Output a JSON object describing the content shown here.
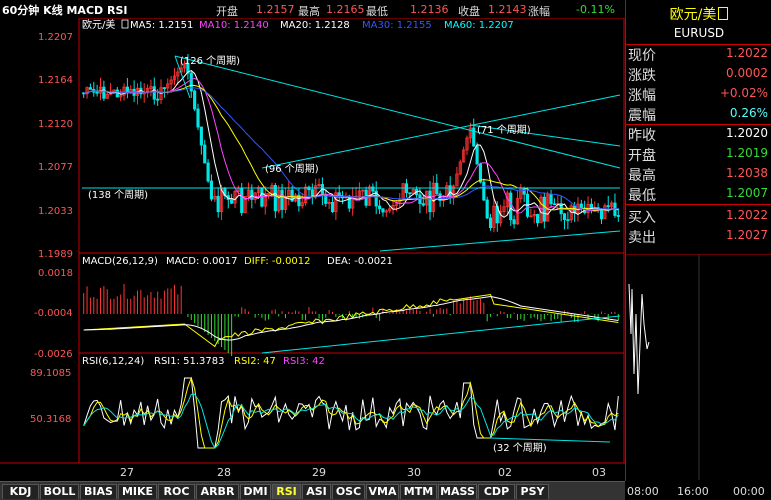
{
  "header": {
    "title": "60分钟 K线 MACD RSI",
    "open_label": "开盘",
    "open": "1.2157",
    "high_label": "最高",
    "high": "1.2165",
    "low_label": "最低",
    "low": "1.2136",
    "close_label": "收盘",
    "close": "1.2143",
    "change_label": "涨幅",
    "change": "-0.11%"
  },
  "kline": {
    "name": "欧元/美",
    "ma5": "MA5: 1.2151",
    "ma10": "MA10: 1.2140",
    "ma20": "MA20: 1.2128",
    "ma30": "MA30: 1.2155",
    "ma60": "MA60: 1.2207",
    "y_ticks": [
      "1.2207",
      "1.2164",
      "1.2120",
      "1.2077",
      "1.2033",
      "1.1989"
    ],
    "annotations": [
      "(126 个周期)",
      "(71 个周期)",
      "(96 个周期)",
      "(138 个周期)"
    ]
  },
  "macd": {
    "label": "MACD(26,12,9)",
    "macd": "MACD: 0.0017",
    "diff": "DIFF: -0.0012",
    "dea": "DEA: -0.0021",
    "y_ticks": [
      "0.0018",
      "-0.0004",
      "-0.0026"
    ]
  },
  "rsi": {
    "label": "RSI(6,12,24)",
    "rsi1": "RSI1: 51.3783",
    "rsi2": "RSI2: 47",
    "rsi3": "RSI3: 42",
    "y_ticks": [
      "89.1085",
      "50.3168"
    ],
    "annotation": "(32 个周期)"
  },
  "xaxis": [
    "27",
    "28",
    "29",
    "30",
    "02",
    "03"
  ],
  "tabs": [
    "KDJ",
    "BOLL",
    "BIAS",
    "MIKE",
    "ROC",
    "ARBR",
    "DMI",
    "RSI",
    "ASI",
    "OSC",
    "VMA",
    "MTM",
    "MASS",
    "CDP",
    "PSY"
  ],
  "active_tab": "RSI",
  "side": {
    "name": "欧元/美",
    "code": "EURUSD",
    "rows": [
      {
        "label": "现价",
        "value": "1.2022",
        "color": "#ff5555"
      },
      {
        "label": "涨跌",
        "value": "0.0002",
        "color": "#ff5555"
      },
      {
        "label": "涨幅",
        "value": "+0.02%",
        "color": "#ff5555"
      },
      {
        "label": "震幅",
        "value": "0.26%",
        "color": "#55ffff"
      },
      {
        "label": "昨收",
        "value": "1.2020",
        "color": "#ffffff"
      },
      {
        "label": "开盘",
        "value": "1.2019",
        "color": "#33dd33"
      },
      {
        "label": "最高",
        "value": "1.2038",
        "color": "#ff5555"
      },
      {
        "label": "最低",
        "value": "1.2007",
        "color": "#33dd33"
      },
      {
        "label": "买入",
        "value": "1.2022",
        "color": "#ff5555"
      },
      {
        "label": "卖出",
        "value": "1.2027",
        "color": "#ff5555"
      }
    ],
    "times": [
      "08:00",
      "16:00",
      "00:00"
    ]
  },
  "colors": {
    "ma5": "#ffffff",
    "ma10": "#ff44ff",
    "ma20": "#ffff00",
    "ma30": "#3355ff",
    "ma60": "#00ffff",
    "up": "#ff3333",
    "down": "#00e5e5"
  }
}
